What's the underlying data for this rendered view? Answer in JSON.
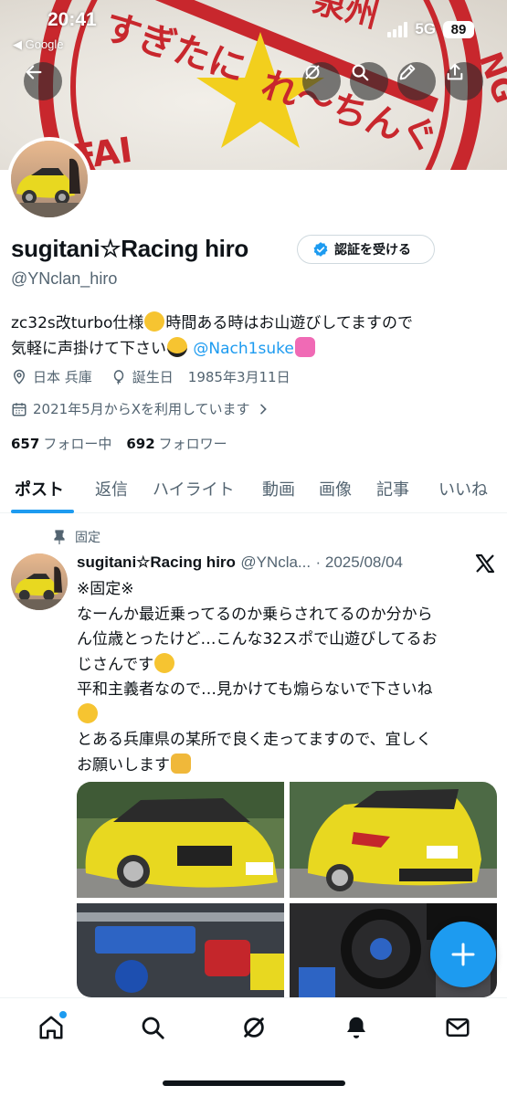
{
  "status_bar": {
    "time": "20:41",
    "back_label": "◀ Google",
    "network": "5G",
    "battery": "89"
  },
  "banner": {
    "sticker_text": "すぎたにれ〜ちんぐ",
    "ring_text_top": "泉州",
    "ring_text_side": "NG",
    "ring_text_left": "FAI"
  },
  "profile": {
    "display_name": "sugitani☆Racing hiro",
    "verify_label": "認証を受ける",
    "handle": "@YNclan_hiro",
    "bio_line1_a": "zc32s改turbo仕様",
    "bio_line1_b": "時間ある時はお山遊びしてますので",
    "bio_line2_a": "気軽に声掛けて下さい",
    "bio_mention": "@Nach1suke",
    "location": "日本 兵庫",
    "birthday_label": "誕生日",
    "birthday": "1985年3月11日",
    "joined": "2021年5月からXを利用しています",
    "following_count": "657",
    "following_label": "フォロー中",
    "followers_count": "692",
    "followers_label": "フォロワー"
  },
  "tabs": [
    "ポスト",
    "返信",
    "ハイライト",
    "動画",
    "画像",
    "記事",
    "いいね"
  ],
  "post": {
    "pinned_label": "固定",
    "author_name": "sugitani☆Racing hiro",
    "author_handle": "@YNcla...",
    "date": "· 2025/08/04",
    "lines": [
      "※固定※",
      "なーんか最近乗ってるのか乗らされてるのか分から",
      "ん位歳とったけど…こんな32スポで山遊びしてるお",
      "じさんです",
      "平和主義者なので…見かけても煽らないで下さいね",
      "",
      "とある兵庫県の某所で良く走ってますので、宜しく",
      "お願いします"
    ]
  },
  "colors": {
    "accent": "#1d9bf0",
    "text": "#0f1419",
    "secondary": "#536471",
    "car_yellow": "#e8d820"
  },
  "icons": {
    "back": "arrow-left-icon",
    "grok": "grok-icon",
    "search": "search-icon",
    "edit": "pencil-icon",
    "share": "share-icon",
    "nav": [
      "home-icon",
      "search-icon",
      "grok-icon",
      "bell-icon",
      "mail-icon"
    ]
  }
}
